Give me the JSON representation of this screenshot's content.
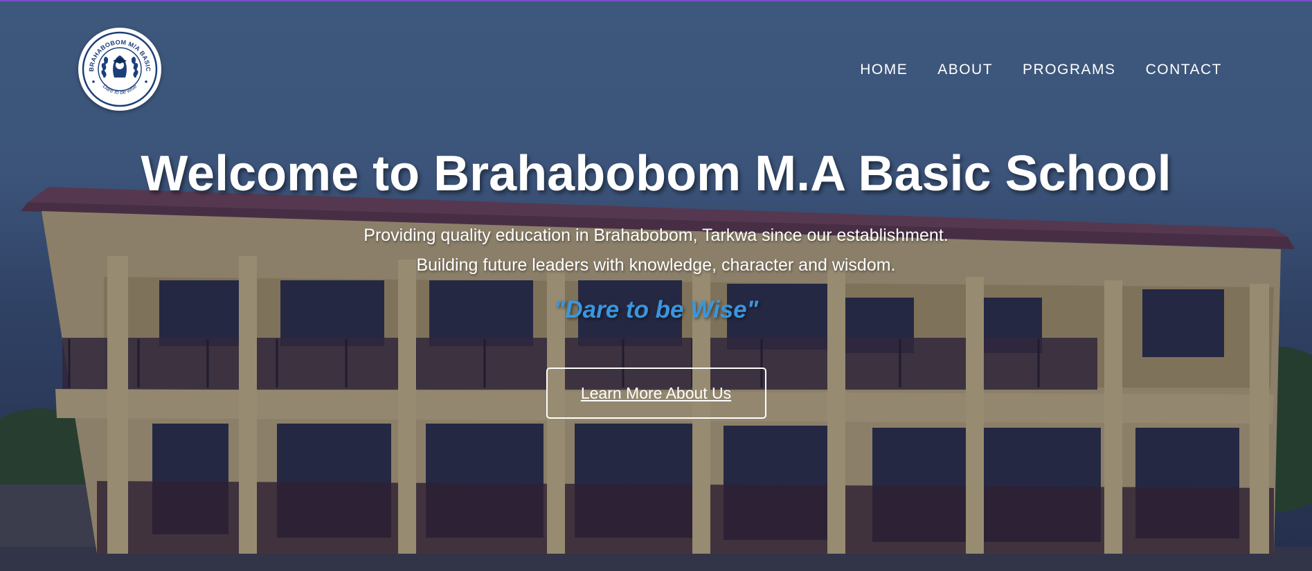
{
  "logo": {
    "ring_text": "BRAHABOBOM M/A BASIC",
    "motto_text": "Dare to be wise"
  },
  "nav": {
    "items": [
      {
        "label": "HOME"
      },
      {
        "label": "ABOUT"
      },
      {
        "label": "PROGRAMS"
      },
      {
        "label": "CONTACT"
      }
    ]
  },
  "hero": {
    "title": "Welcome to Brahabobom M.A Basic School",
    "subtitle_line1": "Providing quality education in Brahabobom, Tarkwa since our establishment.",
    "subtitle_line2": "Building future leaders with knowledge, character and wisdom.",
    "motto": "\"Dare to be Wise\"",
    "cta_label": "Learn More About Us"
  },
  "colors": {
    "accent_blue": "#3a96de",
    "top_border": "#7a4fc6",
    "logo_navy": "#1c3f7a"
  }
}
